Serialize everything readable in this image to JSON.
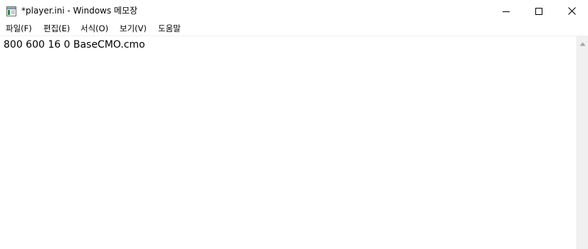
{
  "window": {
    "title": "*player.ini - Windows 메모장"
  },
  "menu": {
    "file": "파일(F)",
    "edit": "편집(E)",
    "format": "서식(O)",
    "view": "보기(V)",
    "help": "도움말"
  },
  "editor": {
    "content": "800 600 16 0 BaseCMO.cmo"
  },
  "icons": {
    "app": "notepad-icon",
    "minimize": "minimize-icon",
    "maximize": "maximize-icon",
    "close": "close-icon",
    "scroll_up": "scroll-up-arrow-icon"
  }
}
